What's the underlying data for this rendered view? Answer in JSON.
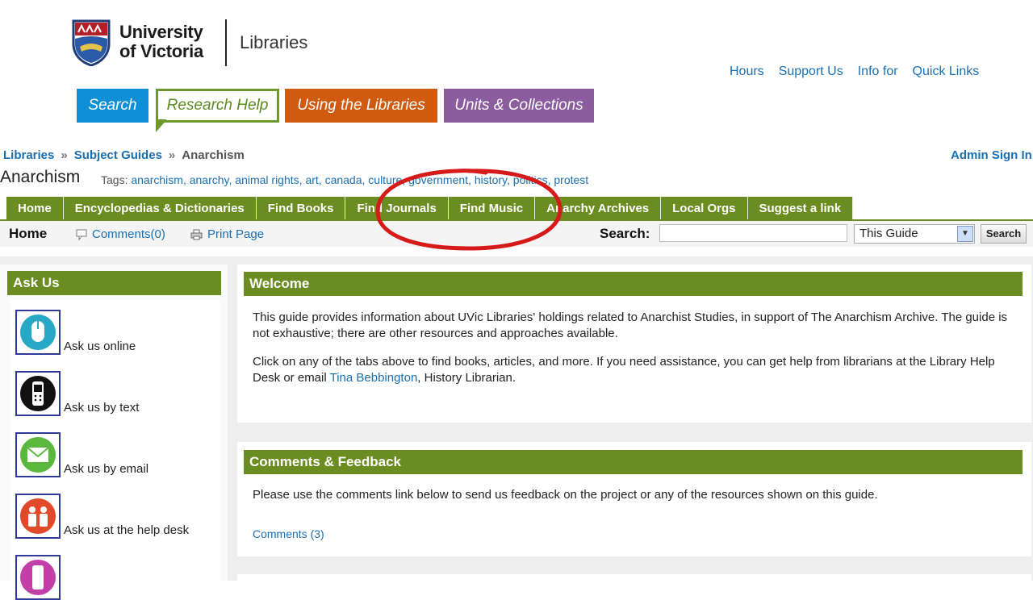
{
  "header": {
    "logo_line1": "University",
    "logo_line2": "of Victoria",
    "logo_section": "Libraries",
    "top_links": [
      "Hours",
      "Support Us",
      "Info for",
      "Quick Links"
    ],
    "nav_tabs": {
      "search": "Search",
      "research_help": "Research Help",
      "using": "Using the Libraries",
      "units": "Units & Collections"
    }
  },
  "breadcrumb": {
    "items": [
      "Libraries",
      "Subject Guides",
      "Anarchism"
    ],
    "separator": "»"
  },
  "admin_link": "Admin Sign In",
  "page_title": "Anarchism",
  "tags": {
    "label": "Tags:",
    "items": [
      "anarchism,",
      "anarchy,",
      "animal rights,",
      "art,",
      "canada,",
      "culture,",
      "government,",
      "history,",
      "politics,",
      "protest"
    ]
  },
  "guide_tabs": [
    "Home",
    "Encyclopedias & Dictionaries",
    "Find Books",
    "Find Journals",
    "Find Music",
    "Anarchy Archives",
    "Local Orgs",
    "Suggest a link"
  ],
  "subbar": {
    "current_page": "Home",
    "comments_link": "Comments(0)",
    "print_link": "Print Page",
    "search_label": "Search:",
    "search_value": "",
    "scope_value": "This Guide",
    "search_button": "Search"
  },
  "ask_us": {
    "title": "Ask Us",
    "items": [
      {
        "label": "Ask us online",
        "icon": "mouse-icon"
      },
      {
        "label": "Ask us by text",
        "icon": "phone-icon"
      },
      {
        "label": "Ask us by email",
        "icon": "email-icon"
      },
      {
        "label": "Ask us at the help desk",
        "icon": "people-icon"
      }
    ]
  },
  "welcome": {
    "title": "Welcome",
    "para1": "This guide provides information about UVic Libraries' holdings related to Anarchist Studies, in support of The Anarchism Archive. The guide is not exhaustive; there are other resources and approaches available.",
    "para2_before": "Click on any of the tabs above to find books, articles, and more.  If you need assistance, you can get help from librarians at the Library Help Desk or email ",
    "para2_link": "Tina Bebbington",
    "para2_after": ", History Librarian."
  },
  "comments": {
    "title": "Comments & Feedback",
    "text": "Please use the comments link below to send us feedback on the project or any of the resources shown on this guide.",
    "link": "Comments (3)"
  },
  "colors": {
    "guide_green": "#6b8c21",
    "link_blue": "#1a6fb0",
    "tab_search": "#0f8fd6",
    "tab_using": "#cf5a10",
    "tab_units": "#8b5c9e",
    "highlight_red": "#d61a1a"
  }
}
